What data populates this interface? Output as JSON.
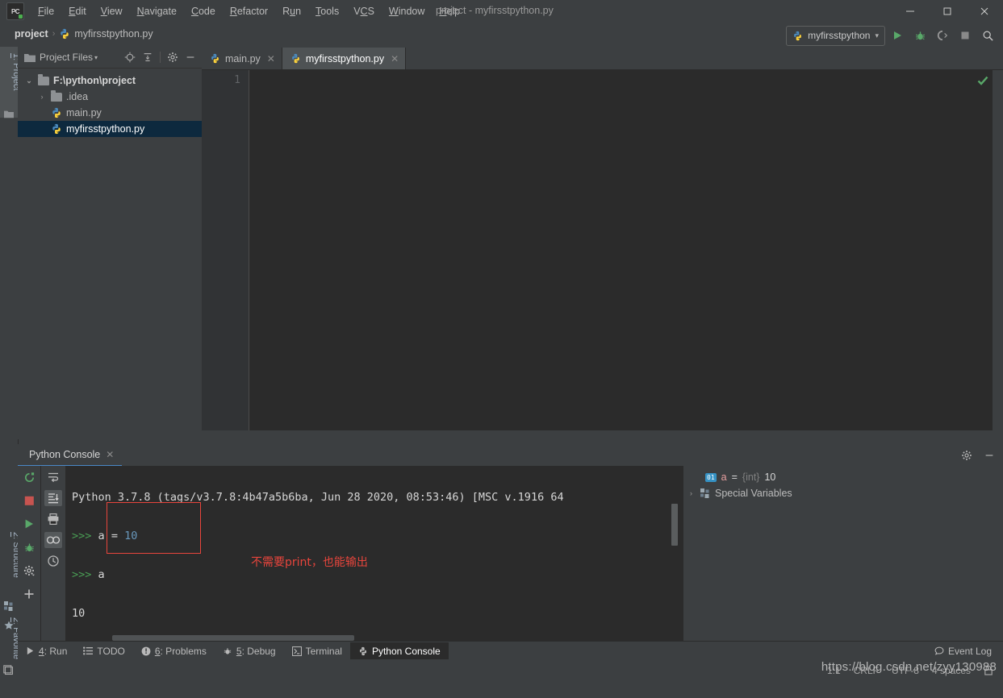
{
  "window": {
    "title": "project - myfirsstpython.py",
    "logo_text": "PC",
    "minimize": "—",
    "maximize": "□",
    "close": "✕"
  },
  "menu": {
    "items": [
      {
        "pre": "",
        "key": "F",
        "post": "ile"
      },
      {
        "pre": "",
        "key": "E",
        "post": "dit"
      },
      {
        "pre": "",
        "key": "V",
        "post": "iew"
      },
      {
        "pre": "",
        "key": "N",
        "post": "avigate"
      },
      {
        "pre": "",
        "key": "C",
        "post": "ode"
      },
      {
        "pre": "",
        "key": "R",
        "post": "efactor"
      },
      {
        "pre": "R",
        "key": "u",
        "post": "n"
      },
      {
        "pre": "",
        "key": "T",
        "post": "ools"
      },
      {
        "pre": "V",
        "key": "C",
        "post": "S"
      },
      {
        "pre": "",
        "key": "W",
        "post": "indow"
      },
      {
        "pre": "",
        "key": "H",
        "post": "elp"
      }
    ]
  },
  "breadcrumb": {
    "project": "project",
    "separator": "›",
    "file": "myfirsstpython.py"
  },
  "toolbar": {
    "run_config": "myfirsstpython",
    "dropdown_arrow": "▾",
    "run_icon": "run-icon",
    "debug_icon": "debug-icon",
    "coverage_icon": "coverage-icon",
    "stop_icon": "stop-icon",
    "search_icon": "search-icon"
  },
  "left_stripe": {
    "project_tab": {
      "pre": "",
      "key": "1",
      "post": ": Project"
    },
    "structure_tab": {
      "pre": "",
      "key": "2",
      "post": ": Structure"
    },
    "favorites_tab": {
      "pre": "",
      "key": "2",
      "post": ": Favorites"
    }
  },
  "project_panel": {
    "title": "Project Files",
    "title_arrow": "▾",
    "icons": [
      "locate-icon",
      "collapse-all-icon",
      "settings-icon",
      "hide-icon"
    ],
    "tree": [
      {
        "indent": 0,
        "arrow": "⌄",
        "icon": "folder",
        "label": "F:\\python\\project",
        "bold": true,
        "selected": false
      },
      {
        "indent": 1,
        "arrow": "›",
        "icon": "folder",
        "label": ".idea",
        "bold": false,
        "selected": false
      },
      {
        "indent": 1,
        "arrow": "",
        "icon": "python",
        "label": "main.py",
        "bold": false,
        "selected": false
      },
      {
        "indent": 1,
        "arrow": "",
        "icon": "python",
        "label": "myfirsstpython.py",
        "bold": false,
        "selected": true
      }
    ]
  },
  "editor": {
    "tabs": [
      {
        "label": "main.py",
        "icon": "python",
        "active": false,
        "close": "✕"
      },
      {
        "label": "myfirsstpython.py",
        "icon": "python",
        "active": true,
        "close": "✕"
      }
    ],
    "line_numbers": [
      "1"
    ],
    "code": "",
    "inspection_status": "check-icon"
  },
  "console": {
    "tab_label": "Python Console",
    "tab_close": "✕",
    "header_icons": [
      "settings-icon",
      "minimize-icon"
    ],
    "toolbar_left": [
      "rerun-icon",
      "stop-icon",
      "run-icon",
      "debug-icon",
      "settings-icon",
      "add-icon"
    ],
    "toolbar_right": [
      "soft-wrap-icon",
      "scroll-to-end-icon",
      "print-icon",
      "preview-icon",
      "history-icon"
    ],
    "lines": [
      {
        "type": "banner",
        "text": "Python 3.7.8 (tags/v3.7.8:4b47a5b6ba, Jun 28 2020, 08:53:46) [MSC v.1916 64"
      },
      {
        "type": "input",
        "prompt": ">>>",
        "code": "a = 10"
      },
      {
        "type": "input",
        "prompt": ">>>",
        "code": "a"
      },
      {
        "type": "output",
        "text": "10"
      },
      {
        "type": "blank",
        "text": ""
      },
      {
        "type": "cursor",
        "prompt": ">>>",
        "code": ""
      }
    ],
    "annotation": "不需要print，也能输出",
    "annotation_color": "#e8453c"
  },
  "variables": {
    "rows": [
      {
        "arrow": "",
        "badge": "01",
        "name": "a",
        "eq": " = ",
        "type": "{int}",
        "value": "10"
      },
      {
        "arrow": "›",
        "badge": "",
        "name": "Special Variables",
        "eq": "",
        "type": "",
        "value": ""
      }
    ]
  },
  "bottom_bar": {
    "items": [
      {
        "icon": "run-icon",
        "pre": "",
        "key": "4",
        "post": ": Run",
        "active": false
      },
      {
        "icon": "todo-icon",
        "pre": "",
        "key": "",
        "post": "TODO",
        "active": false
      },
      {
        "icon": "problems-icon",
        "pre": "",
        "key": "6",
        "post": ": Problems",
        "active": false
      },
      {
        "icon": "debug-icon",
        "pre": "",
        "key": "5",
        "post": ": Debug",
        "active": false
      },
      {
        "icon": "terminal-icon",
        "pre": "",
        "key": "",
        "post": "Terminal",
        "active": false
      },
      {
        "icon": "python-console-icon",
        "pre": "",
        "key": "",
        "post": "Python Console",
        "active": true
      }
    ],
    "event_log": "Event Log",
    "event_log_icon": "balloon-icon"
  },
  "status_bar": {
    "caret_position": "1:1",
    "line_separator": "CRLF",
    "encoding": "UTF-8",
    "indent": "4 spaces",
    "lock_icon": "lock-icon",
    "layout_icon": "layout-icon",
    "watermark": "https://blog.csdn.net/zyy130988"
  },
  "colors": {
    "background": "#3c3f41",
    "editor_bg": "#2b2b2b",
    "selection": "#0d293e",
    "accent_blue": "#4a88c7",
    "prompt_green": "#499c54",
    "number_blue": "#6897bb",
    "annotation_red": "#e8453c"
  }
}
